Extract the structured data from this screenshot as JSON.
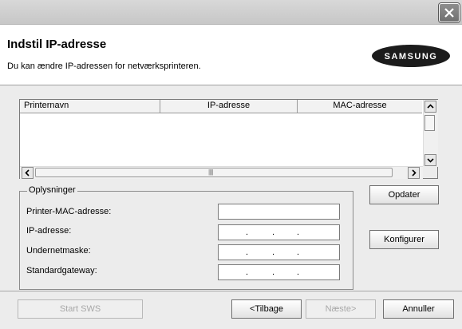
{
  "window": {
    "close_icon": "close-icon"
  },
  "header": {
    "title": "Indstil IP-adresse",
    "subtitle": "Du kan ændre IP-adressen for netværksprinteren.",
    "logo_text": "SAMSUNG"
  },
  "printer_list": {
    "columns": [
      "Printernavn",
      "IP-adresse",
      "MAC-adresse"
    ],
    "rows": [],
    "scroll_thumb_grip": "|||||"
  },
  "info_group": {
    "legend": "Oplysninger",
    "fields": [
      {
        "label": "Printer-MAC-adresse:",
        "value": ""
      },
      {
        "label": "IP-adresse:",
        "value": ". . ."
      },
      {
        "label": "Undernetmaske:",
        "value": ". . ."
      },
      {
        "label": "Standardgateway:",
        "value": ". . ."
      }
    ]
  },
  "buttons": {
    "update": "Opdater",
    "configure": "Konfigurer",
    "start_sws": "Start SWS",
    "back": "<Tilbage",
    "next": "Næste>",
    "cancel": "Annuller"
  },
  "colors": {
    "dialog_bg": "#ececec",
    "header_bg": "#ffffff",
    "logo_bg": "#1c1c1c"
  }
}
